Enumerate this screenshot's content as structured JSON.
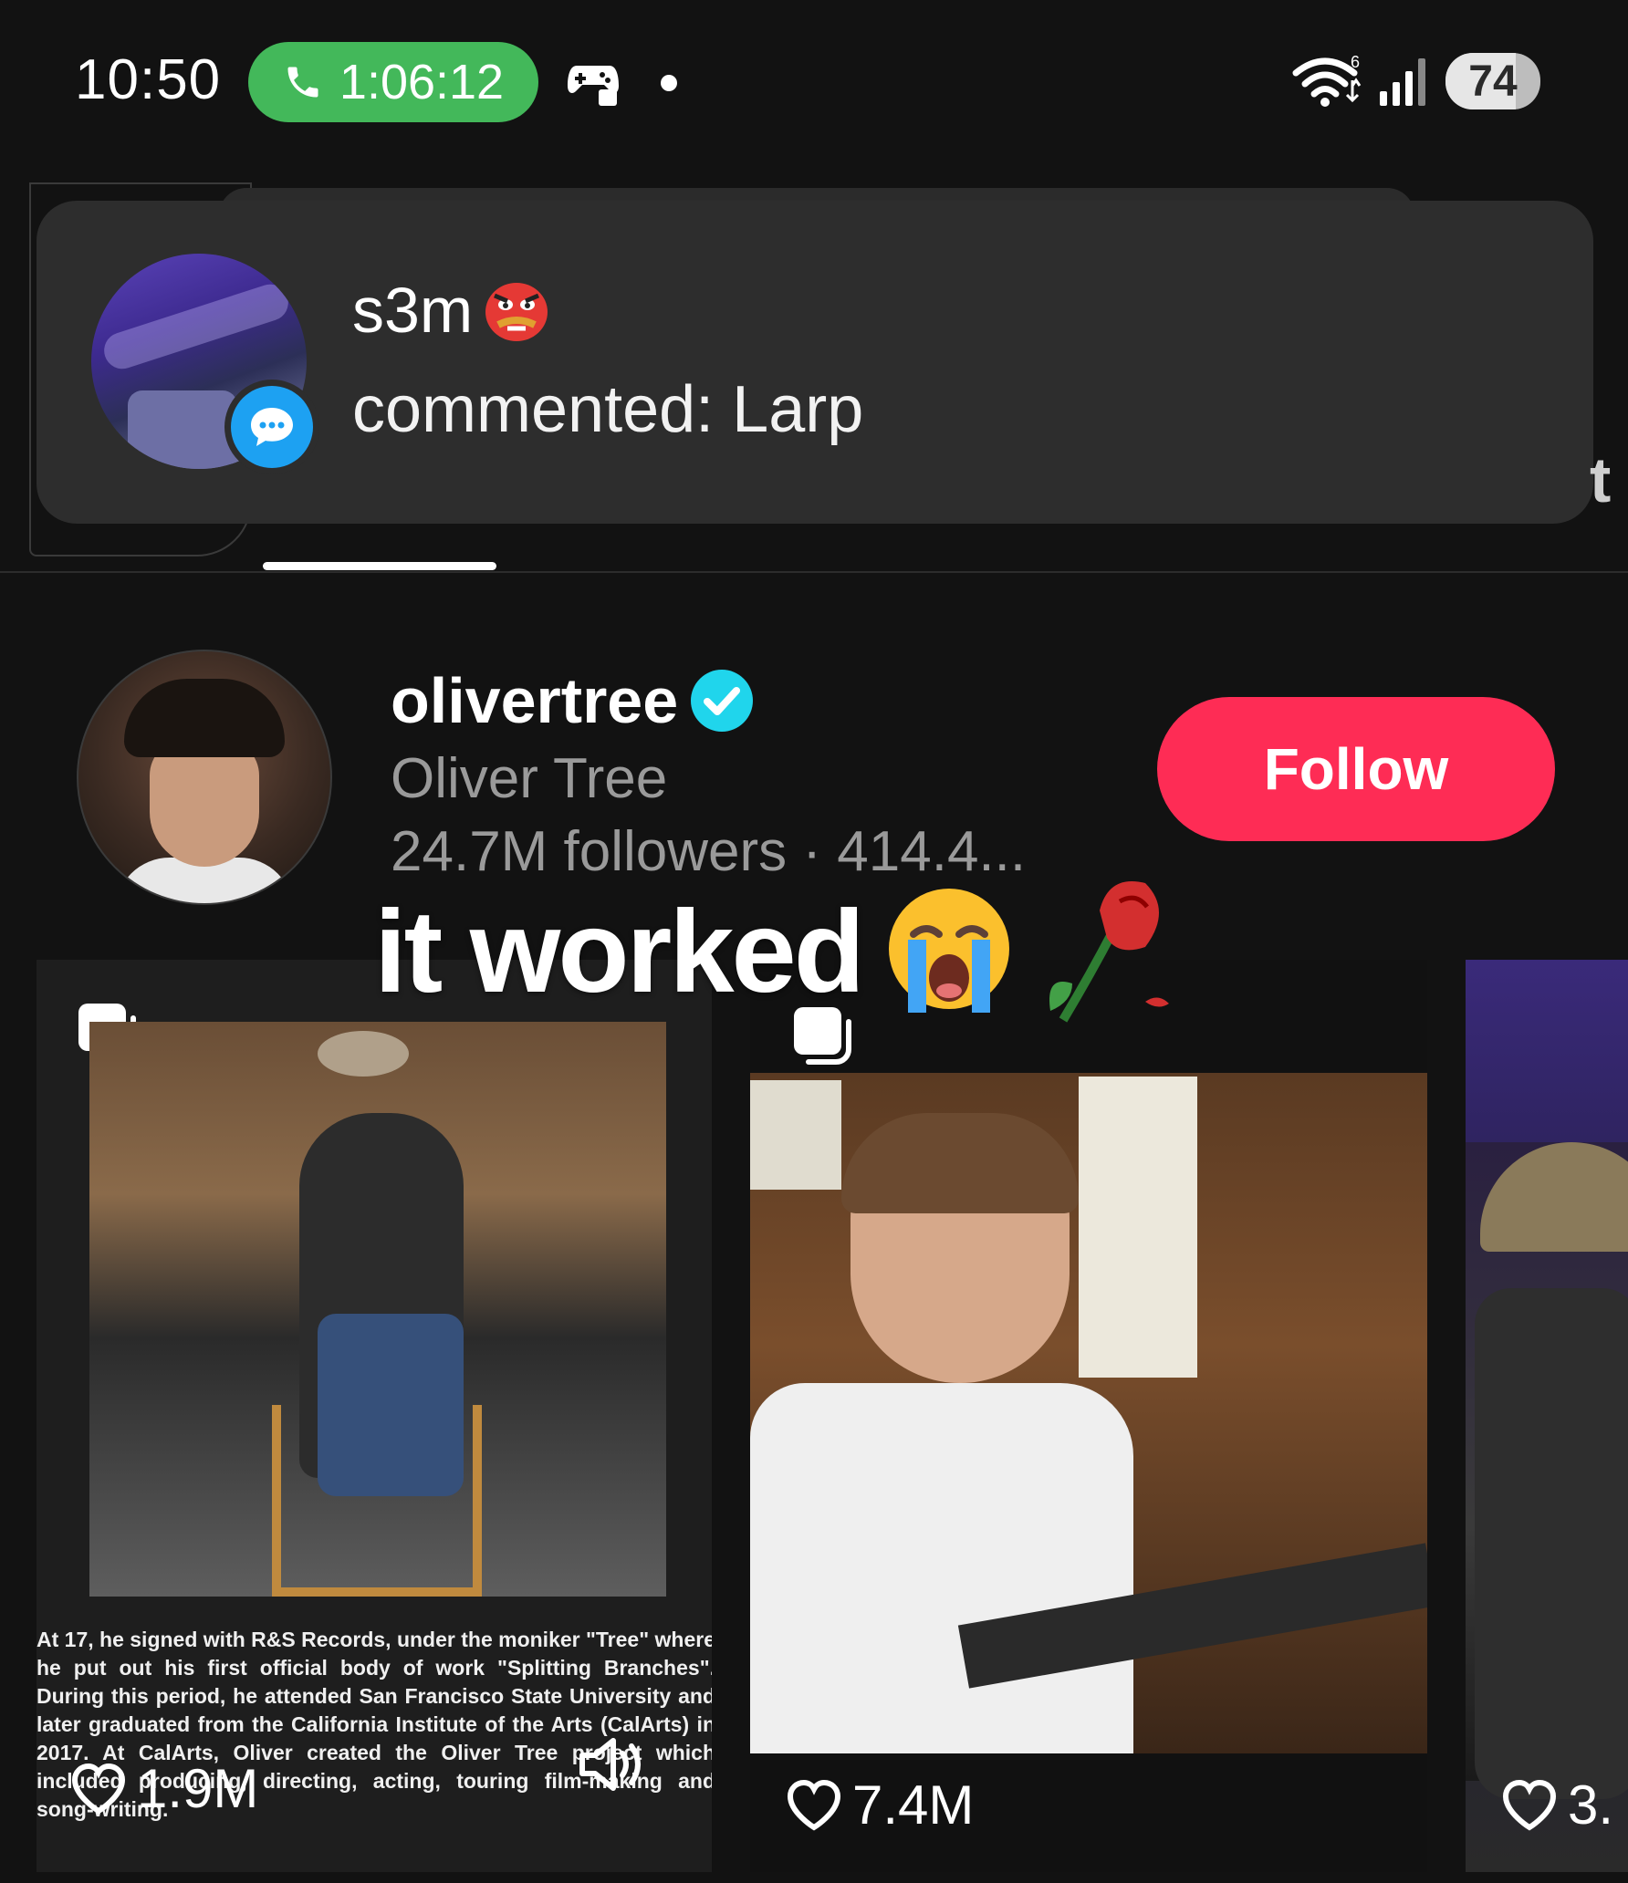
{
  "status_bar": {
    "time": "10:50",
    "call_timer": "1:06:12",
    "wifi_label": "6",
    "battery": "74",
    "battery_level": 0.74
  },
  "notification": {
    "username": "s3m",
    "message": "commented: Larp",
    "edge_text": "t"
  },
  "profile": {
    "username": "olivertree",
    "display_name": "Oliver Tree",
    "stats": "24.7M followers · 414.4...",
    "follow_label": "Follow"
  },
  "overlay_text": "it worked",
  "videos": [
    {
      "likes": "1.9M",
      "caption": "At 17, he signed with R&S Records, under the moniker \"Tree\" where he put out his first official body of work \"Splitting Branches\". During this period, he attended San Francisco State University and later graduated from the California Institute of the Arts (CalArts) in 2017. At CalArts, Oliver created the Oliver Tree project which included producing, directing, acting, touring film-making and song-writing."
    },
    {
      "likes": "7.4M"
    },
    {
      "likes": "3."
    }
  ],
  "colors": {
    "background": "#121212",
    "call_green": "#43b85a",
    "follow_red": "#fe2c55",
    "verified_cyan": "#20d5ec",
    "comment_blue": "#1da1f2"
  },
  "icons": [
    "phone-icon",
    "game-controller-icon",
    "wifi-icon",
    "signal-icon",
    "comment-bubble-icon",
    "verified-icon",
    "crying-emoji-icon",
    "rose-emoji-icon",
    "goblin-emoji-icon",
    "multi-photo-icon",
    "heart-icon",
    "mute-icon"
  ]
}
